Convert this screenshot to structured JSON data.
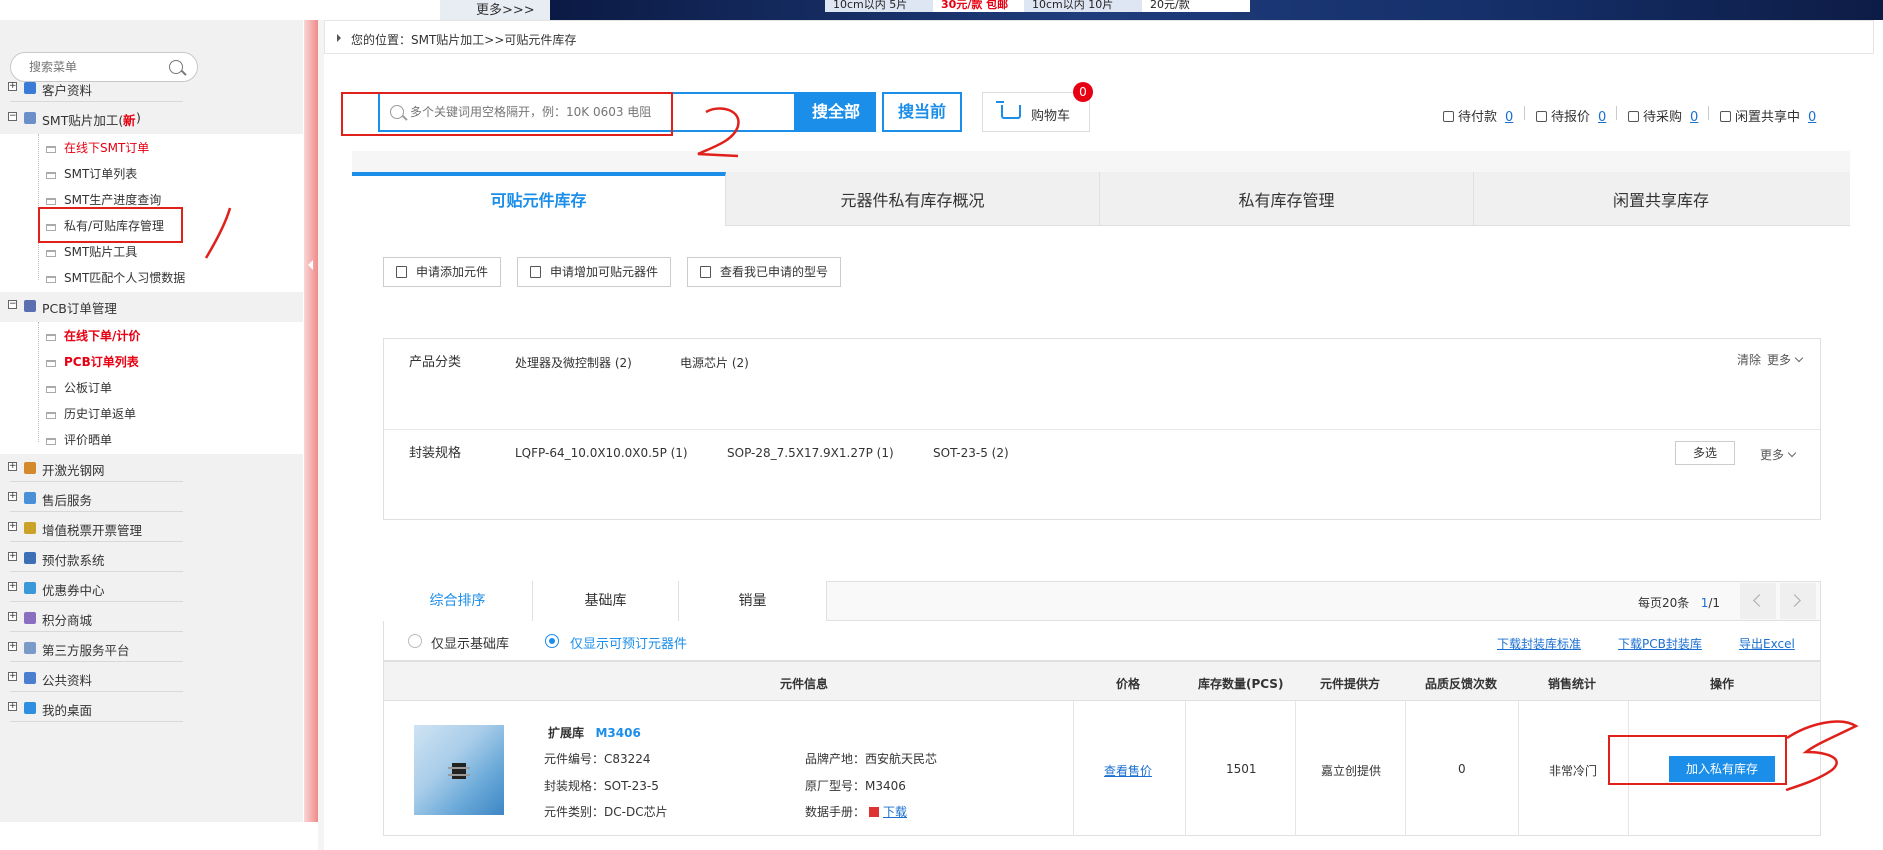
{
  "banner": {
    "more_label": "更多>>>",
    "promo1_text": "10cm以内 5片",
    "promo1_price": "30元/款 包邮",
    "promo2_text": "10cm以内 10片",
    "promo2_price": "20元/款"
  },
  "sidebar": {
    "search_placeholder": "搜索菜单",
    "sections": [
      {
        "label": "客户资料",
        "expanded": false
      },
      {
        "label": "SMT贴片加工(",
        "badge": "新",
        "tail": ")",
        "expanded": true,
        "items": [
          {
            "label": "在线下SMT订单",
            "highlight": true
          },
          {
            "label": "SMT订单列表"
          },
          {
            "label": "SMT生产进度查询"
          },
          {
            "label": "私有/可贴库存管理",
            "selected": true
          },
          {
            "label": "SMT贴片工具"
          },
          {
            "label": "SMT匹配个人习惯数据"
          }
        ]
      },
      {
        "label": "PCB订单管理",
        "expanded": true,
        "items": [
          {
            "label": "在线下单/计价",
            "highlight": true
          },
          {
            "label": "PCB订单列表",
            "highlight": true
          },
          {
            "label": "公板订单"
          },
          {
            "label": "历史订单返单"
          },
          {
            "label": "评价晒单"
          }
        ]
      },
      {
        "label": "开激光钢网"
      },
      {
        "label": "售后服务"
      },
      {
        "label": "增值税票开票管理"
      },
      {
        "label": "预付款系统"
      },
      {
        "label": "优惠券中心"
      },
      {
        "label": "积分商城"
      },
      {
        "label": "第三方服务平台"
      },
      {
        "label": "公共资料"
      },
      {
        "label": "我的桌面"
      }
    ]
  },
  "breadcrumb": "您的位置：SMT贴片加工>>可贴元件库存",
  "search": {
    "placeholder": "多个关键词用空格隔开，例：10K 0603 电阻",
    "search_all": "搜全部",
    "search_current": "搜当前",
    "cart_label": "购物车",
    "cart_count": "0"
  },
  "status_links": [
    {
      "label": "待付款",
      "count": "0"
    },
    {
      "label": "待报价",
      "count": "0"
    },
    {
      "label": "待采购",
      "count": "0"
    },
    {
      "label": "闲置共享中",
      "count": "0"
    }
  ],
  "tabs": [
    "可贴元件库存",
    "元器件私有库存概况",
    "私有库存管理",
    "闲置共享库存"
  ],
  "action_buttons": [
    "申请添加元件",
    "申请增加可贴元器件",
    "查看我已申请的型号"
  ],
  "filters": {
    "category_title": "产品分类",
    "categories": [
      "处理器及微控制器 (2)",
      "电源芯片 (2)"
    ],
    "clear_label": "清除",
    "more_label": "更多",
    "package_title": "封装规格",
    "packages": [
      "LQFP-64_10.0X10.0X0.5P (1)",
      "SOP-28_7.5X17.9X1.27P (1)",
      "SOT-23-5 (2)"
    ],
    "multi_label": "多选",
    "more_label2": "更多"
  },
  "sort_tabs": [
    "综合排序",
    "基础库",
    "销量"
  ],
  "pagination": {
    "per_page": "每页20条",
    "current": "1",
    "total": "/1"
  },
  "radio": {
    "option1": "仅显示基础库",
    "option2": "仅显示可预订元器件",
    "selected": 2
  },
  "download_links": [
    "下载封装库标准",
    "下载PCB封装库",
    "导出Excel"
  ],
  "table": {
    "headers": [
      "元件信息",
      "价格",
      "库存数量(PCS)",
      "元件提供方",
      "品质反馈次数",
      "销售统计",
      "操作"
    ],
    "rows": [
      {
        "tag": "扩展库",
        "model": "M3406",
        "code_label": "元件编号：",
        "code": "C83224",
        "package_label": "封装规格：",
        "package": "SOT-23-5",
        "category_label": "元件类别：",
        "category": "DC-DC芯片",
        "brand_label": "品牌产地：",
        "brand": "西安航天民芯",
        "mfr_label": "原厂型号：",
        "mfr": "M3406",
        "datasheet_label": "数据手册：",
        "datasheet": "下载",
        "price": "查看售价",
        "stock": "1501",
        "provider": "嘉立创提供",
        "feedback": "0",
        "sales": "非常冷门",
        "action": "加入私有库存"
      }
    ]
  },
  "colors": {
    "accent": "#1b8eea",
    "red": "#e60012",
    "annotation": "#e0201a"
  }
}
